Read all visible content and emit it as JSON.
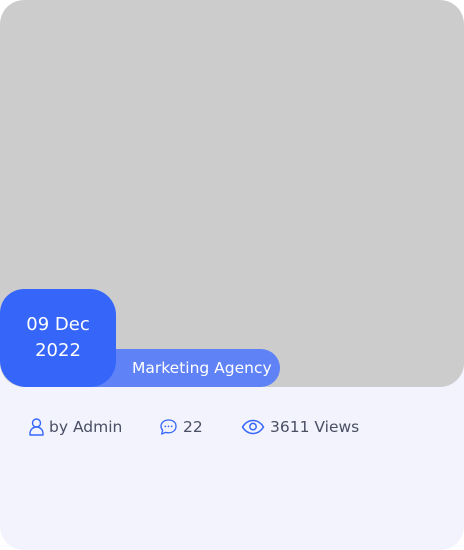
{
  "post": {
    "date_line1": "09 Dec",
    "date_line2": "2022",
    "category": "Marketing Agency",
    "author": "by Admin",
    "comments": "22",
    "views": "3611 Views"
  },
  "icons": {
    "author": "user-icon",
    "comments": "chat-bubble-icon",
    "views": "eye-icon"
  },
  "colors": {
    "accent": "#3566f9",
    "category_bg": "#5f82f6",
    "image_placeholder": "#cccccc",
    "card_bg": "#f2f3fd",
    "meta_text": "#4a4f63"
  }
}
